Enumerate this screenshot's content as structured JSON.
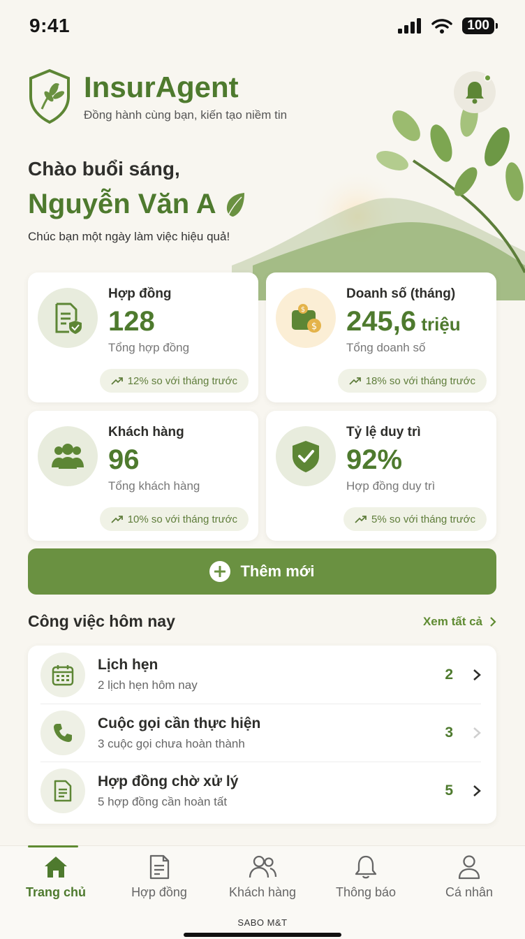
{
  "status_bar": {
    "time": "9:41",
    "battery": "100"
  },
  "app": {
    "name": "InsurAgent",
    "tagline": "Đồng hành cùng bạn, kiến tạo niềm tin"
  },
  "greeting": {
    "line": "Chào buổi sáng,",
    "name": "Nguyễn Văn A",
    "sub": "Chúc bạn một ngày làm việc hiệu quả!"
  },
  "stats": [
    {
      "label": "Hợp đồng",
      "value": "128",
      "unit": "",
      "sub": "Tổng hợp đồng",
      "trend": "12% so với tháng trước",
      "icon": "contract-shield-icon"
    },
    {
      "label": "Doanh số (tháng)",
      "value": "245,6",
      "unit": " triệu",
      "sub": "Tổng doanh số",
      "trend": "18% so với tháng trước",
      "icon": "wallet-coin-icon"
    },
    {
      "label": "Khách hàng",
      "value": "96",
      "unit": "",
      "sub": "Tổng khách hàng",
      "trend": "10% so với tháng trước",
      "icon": "customers-icon"
    },
    {
      "label": "Tỷ lệ duy trì",
      "value": "92%",
      "unit": "",
      "sub": "Hợp đồng duy trì",
      "trend": "5% so với tháng trước",
      "icon": "shield-check-icon"
    }
  ],
  "add_button": {
    "label": "Thêm mới"
  },
  "today": {
    "title": "Công việc hôm nay",
    "see_all": "Xem tất cả",
    "items": [
      {
        "title": "Lịch hẹn",
        "sub": "2 lịch hẹn hôm nay",
        "count": "2",
        "icon": "calendar-icon"
      },
      {
        "title": "Cuộc gọi cần thực hiện",
        "sub": "3 cuộc gọi chưa hoàn thành",
        "count": "3",
        "icon": "phone-icon"
      },
      {
        "title": "Hợp đồng chờ xử lý",
        "sub": "5 hợp đồng cần hoàn tất",
        "count": "5",
        "icon": "document-icon"
      }
    ]
  },
  "tabs": [
    {
      "label": "Trang chủ",
      "icon": "home-icon",
      "active": true
    },
    {
      "label": "Hợp đồng",
      "icon": "contract-icon",
      "active": false
    },
    {
      "label": "Khách hàng",
      "icon": "users-icon",
      "active": false
    },
    {
      "label": "Thông báo",
      "icon": "bell-icon",
      "active": false
    },
    {
      "label": "Cá nhân",
      "icon": "person-icon",
      "active": false
    }
  ],
  "footer_brand": "SABO M&T",
  "colors": {
    "primary": "#4e7a2e",
    "button": "#6a9141",
    "background": "#f8f6f0",
    "trend_bg": "#f0f2e6",
    "accent_warm": "#fbeed5"
  }
}
